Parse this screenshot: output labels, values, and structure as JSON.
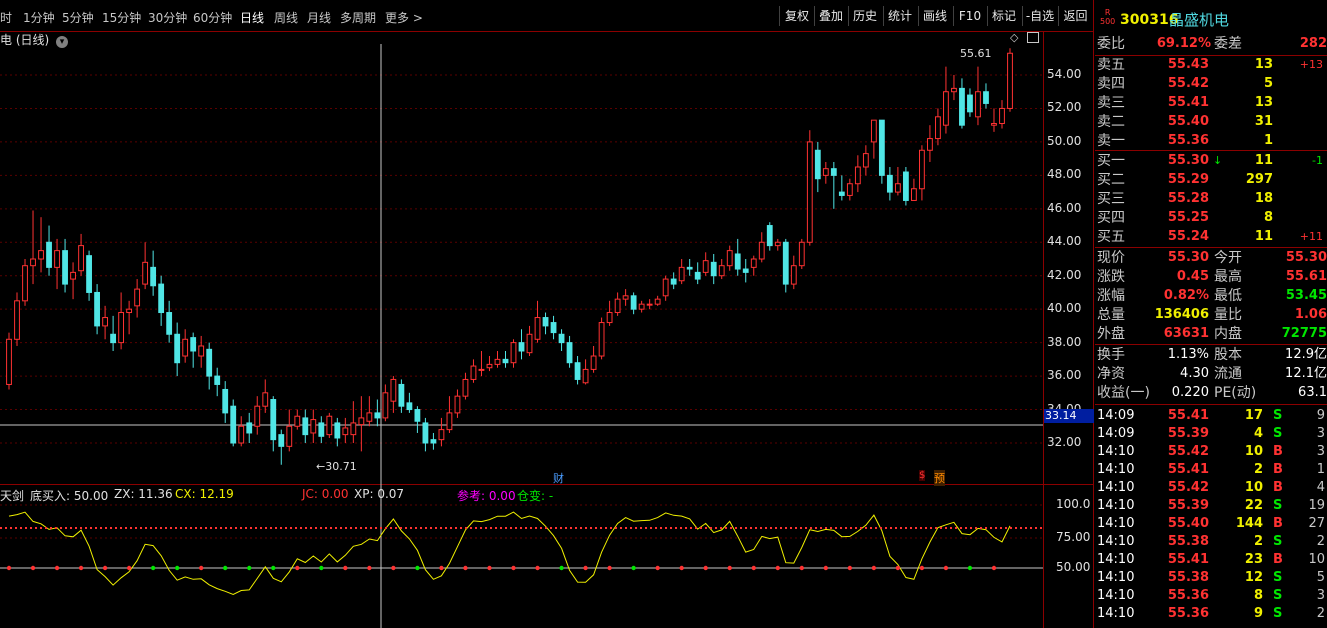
{
  "toolbar": {
    "periods": [
      "时",
      "1分钟",
      "5分钟",
      "15分钟",
      "30分钟",
      "60分钟",
      "日线",
      "周线",
      "月线",
      "多周期",
      "更多 >"
    ],
    "tools": [
      "复权",
      "叠加",
      "历史",
      "统计",
      "画线",
      "F10",
      "标记",
      "-自选",
      "返回"
    ]
  },
  "chart": {
    "title": "电 (日线)",
    "annotations": {
      "high": "55.61",
      "low": "30.71",
      "cursor_price": "33.14",
      "fin_marker": "财",
      "s_marker": "$",
      "yu_marker": "预"
    },
    "y_ticks": [
      "54.00",
      "52.00",
      "50.00",
      "48.00",
      "46.00",
      "44.00",
      "42.00",
      "40.00",
      "38.00",
      "36.00",
      "34.00",
      "32.00"
    ],
    "indicator_y_ticks": [
      "100.0",
      "75.00",
      "50.00"
    ]
  },
  "indicator": {
    "name": "天剑",
    "items": [
      {
        "label": "底买入: 50.00",
        "color": "#e0e0e0"
      },
      {
        "label": "ZX: 11.36",
        "color": "#e0e0e0"
      },
      {
        "label": "CX: 12.19",
        "color": "#f0f000"
      },
      {
        "label": "JC: 0.00",
        "color": "#ff3232"
      },
      {
        "label": "XP: 0.07",
        "color": "#e0e0e0"
      },
      {
        "label": "参考: 0.00",
        "color": "#ff00ff"
      },
      {
        "label": "仓变: -",
        "color": "#00e600"
      }
    ]
  },
  "chart_data": {
    "type": "candlestick",
    "title": "",
    "ylim": [
      30.0,
      56.5
    ],
    "up_color": "#ff3232",
    "down_color": "#50e6e6",
    "candles": [
      [
        35.5,
        38.2,
        35.2,
        38.6
      ],
      [
        38.2,
        40.5,
        37.8,
        41.0
      ],
      [
        40.5,
        42.6,
        40.2,
        43.0
      ],
      [
        42.6,
        43.0,
        41.5,
        45.9
      ],
      [
        43.0,
        43.5,
        42.2,
        45.5
      ],
      [
        44.0,
        42.5,
        42.0,
        45.0
      ],
      [
        42.5,
        43.5,
        41.2,
        44.2
      ],
      [
        43.5,
        41.5,
        41.0,
        44.2
      ],
      [
        41.8,
        42.2,
        40.6,
        42.8
      ],
      [
        42.3,
        43.8,
        42.0,
        44.5
      ],
      [
        43.2,
        41.0,
        40.5,
        43.5
      ],
      [
        41.0,
        39.0,
        38.5,
        41.5
      ],
      [
        39.0,
        39.5,
        38.2,
        40.2
      ],
      [
        38.5,
        38.0,
        37.5,
        39.6
      ],
      [
        38.0,
        39.8,
        37.6,
        41.0
      ],
      [
        39.8,
        40.0,
        38.5,
        40.5
      ],
      [
        40.2,
        41.2,
        39.5,
        41.8
      ],
      [
        41.5,
        42.8,
        41.2,
        44.0
      ],
      [
        42.5,
        41.4,
        40.8,
        43.5
      ],
      [
        41.5,
        39.8,
        39.0,
        42.0
      ],
      [
        39.8,
        38.5,
        38.0,
        40.5
      ],
      [
        38.5,
        36.8,
        36.0,
        39.2
      ],
      [
        37.2,
        38.2,
        36.8,
        38.8
      ],
      [
        38.3,
        37.5,
        36.5,
        38.6
      ],
      [
        37.2,
        37.8,
        36.5,
        38.4
      ],
      [
        37.6,
        36.0,
        35.2,
        38.0
      ],
      [
        36.0,
        35.5,
        34.8,
        36.5
      ],
      [
        35.2,
        33.8,
        33.2,
        35.7
      ],
      [
        34.2,
        32.0,
        31.8,
        34.6
      ],
      [
        32.0,
        33.0,
        31.8,
        33.6
      ],
      [
        33.2,
        32.6,
        32.0,
        33.8
      ],
      [
        33.0,
        34.2,
        32.5,
        34.8
      ],
      [
        34.2,
        35.0,
        33.8,
        35.8
      ],
      [
        34.6,
        32.2,
        31.5,
        34.8
      ],
      [
        32.5,
        31.8,
        30.7,
        32.8
      ],
      [
        31.8,
        33.0,
        31.5,
        34.0
      ],
      [
        33.0,
        33.6,
        32.8,
        34.0
      ],
      [
        33.5,
        32.5,
        32.0,
        34.0
      ],
      [
        32.6,
        33.4,
        32.0,
        34.0
      ],
      [
        33.2,
        32.4,
        32.0,
        33.6
      ],
      [
        32.5,
        33.6,
        32.3,
        33.8
      ],
      [
        33.2,
        32.3,
        31.8,
        33.5
      ],
      [
        32.5,
        32.9,
        32.0,
        33.5
      ],
      [
        32.5,
        33.2,
        32.0,
        34.5
      ],
      [
        33.1,
        33.5,
        31.5,
        34.8
      ],
      [
        33.3,
        33.8,
        33.0,
        34.8
      ],
      [
        33.8,
        33.5,
        33.0,
        34.6
      ],
      [
        33.5,
        35.0,
        33.3,
        35.5
      ],
      [
        34.5,
        35.8,
        33.8,
        36.0
      ],
      [
        35.5,
        34.2,
        33.8,
        35.8
      ],
      [
        34.4,
        34.0,
        33.8,
        35.0
      ],
      [
        34.0,
        33.3,
        32.6,
        34.2
      ],
      [
        33.2,
        32.0,
        31.5,
        33.5
      ],
      [
        32.2,
        32.0,
        31.6,
        32.6
      ],
      [
        32.2,
        32.8,
        31.8,
        33.5
      ],
      [
        32.8,
        33.8,
        32.6,
        34.8
      ],
      [
        33.8,
        34.8,
        33.5,
        35.2
      ],
      [
        34.8,
        35.8,
        34.6,
        36.2
      ],
      [
        35.8,
        36.6,
        35.6,
        37.0
      ],
      [
        36.4,
        36.4,
        36.0,
        37.5
      ],
      [
        36.5,
        36.7,
        36.3,
        37.2
      ],
      [
        36.7,
        37.0,
        36.5,
        37.5
      ],
      [
        37.0,
        36.8,
        36.5,
        37.5
      ],
      [
        36.8,
        38.0,
        36.5,
        38.2
      ],
      [
        38.0,
        37.5,
        37.0,
        38.8
      ],
      [
        37.4,
        38.5,
        37.2,
        39.0
      ],
      [
        38.2,
        39.5,
        38.0,
        40.5
      ],
      [
        39.5,
        39.0,
        38.5,
        39.8
      ],
      [
        39.2,
        38.6,
        38.2,
        39.6
      ],
      [
        38.5,
        38.0,
        37.5,
        38.8
      ],
      [
        38.0,
        36.8,
        36.5,
        38.4
      ],
      [
        36.8,
        35.8,
        35.5,
        37.2
      ],
      [
        35.6,
        36.4,
        35.5,
        37.0
      ],
      [
        36.4,
        37.2,
        36.2,
        37.8
      ],
      [
        37.2,
        39.2,
        37.0,
        39.5
      ],
      [
        39.2,
        39.8,
        39.0,
        40.5
      ],
      [
        39.8,
        40.6,
        39.6,
        41.0
      ],
      [
        40.6,
        40.8,
        40.2,
        41.2
      ],
      [
        40.8,
        40.0,
        39.7,
        41.0
      ],
      [
        40.0,
        40.3,
        39.8,
        40.5
      ],
      [
        40.3,
        40.3,
        40.0,
        40.6
      ],
      [
        40.3,
        40.6,
        40.2,
        40.8
      ],
      [
        40.8,
        41.8,
        40.5,
        42.0
      ],
      [
        41.8,
        41.5,
        41.2,
        42.2
      ],
      [
        41.7,
        42.5,
        41.5,
        43.0
      ],
      [
        42.5,
        42.4,
        42.0,
        43.0
      ],
      [
        42.2,
        41.8,
        41.5,
        42.8
      ],
      [
        42.2,
        42.9,
        42.0,
        43.4
      ],
      [
        42.8,
        42.0,
        41.5,
        43.3
      ],
      [
        42.0,
        42.6,
        41.8,
        43.0
      ],
      [
        42.6,
        43.5,
        42.3,
        43.8
      ],
      [
        43.3,
        42.4,
        42.0,
        44.2
      ],
      [
        42.4,
        42.2,
        41.6,
        43.0
      ],
      [
        42.5,
        43.0,
        42.0,
        43.2
      ],
      [
        43.0,
        44.0,
        42.8,
        44.6
      ],
      [
        45.0,
        43.8,
        43.5,
        45.2
      ],
      [
        43.8,
        44.0,
        43.5,
        44.2
      ],
      [
        44.0,
        41.5,
        41.0,
        44.2
      ],
      [
        41.5,
        42.6,
        41.2,
        43.2
      ],
      [
        42.6,
        44.0,
        42.4,
        44.2
      ],
      [
        44.0,
        50.0,
        43.8,
        50.7
      ],
      [
        49.5,
        47.8,
        47.0,
        50.0
      ],
      [
        48.0,
        48.4,
        47.5,
        48.8
      ],
      [
        48.4,
        48.0,
        46.0,
        48.8
      ],
      [
        47.0,
        46.8,
        46.5,
        48.0
      ],
      [
        46.8,
        47.5,
        46.5,
        47.8
      ],
      [
        47.5,
        48.5,
        47.0,
        49.2
      ],
      [
        48.5,
        49.3,
        48.0,
        49.8
      ],
      [
        50.0,
        51.3,
        49.0,
        51.3
      ],
      [
        51.3,
        48.0,
        47.5,
        51.3
      ],
      [
        48.0,
        47.0,
        46.5,
        48.5
      ],
      [
        47.0,
        47.5,
        46.8,
        48.5
      ],
      [
        48.2,
        46.5,
        46.2,
        48.5
      ],
      [
        46.5,
        47.2,
        46.5,
        47.8
      ],
      [
        47.2,
        49.5,
        46.5,
        49.8
      ],
      [
        49.5,
        50.2,
        48.8,
        51.0
      ],
      [
        50.2,
        51.5,
        49.8,
        52.0
      ],
      [
        51.0,
        53.0,
        50.5,
        54.5
      ],
      [
        53.0,
        53.2,
        52.5,
        54.0
      ],
      [
        53.2,
        51.0,
        50.8,
        53.8
      ],
      [
        52.8,
        51.8,
        51.5,
        53.2
      ],
      [
        51.5,
        53.0,
        51.0,
        54.5
      ],
      [
        53.0,
        52.3,
        52.0,
        53.5
      ],
      [
        51.0,
        51.1,
        50.6,
        52.0
      ],
      [
        51.1,
        52.0,
        50.8,
        52.5
      ],
      [
        52.0,
        55.3,
        51.8,
        55.6
      ]
    ]
  },
  "quote": {
    "badge_top": "R",
    "badge_bottom": "500",
    "code": "300316",
    "name": "晶盛机电",
    "webi": {
      "label1": "委比",
      "val1": "69.12%",
      "label2": "委差",
      "val2": "282"
    },
    "asks": [
      {
        "label": "卖五",
        "price": "55.43",
        "vol": "13",
        "chg": "+13"
      },
      {
        "label": "卖四",
        "price": "55.42",
        "vol": "5",
        "chg": ""
      },
      {
        "label": "卖三",
        "price": "55.41",
        "vol": "13",
        "chg": ""
      },
      {
        "label": "卖二",
        "price": "55.40",
        "vol": "31",
        "chg": ""
      },
      {
        "label": "卖一",
        "price": "55.36",
        "vol": "1",
        "chg": ""
      }
    ],
    "bids": [
      {
        "label": "买一",
        "price": "55.30",
        "vol": "11",
        "chg": "-1",
        "arrow": "↓"
      },
      {
        "label": "买二",
        "price": "55.29",
        "vol": "297",
        "chg": "",
        "arrow": ""
      },
      {
        "label": "买三",
        "price": "55.28",
        "vol": "18",
        "chg": "",
        "arrow": ""
      },
      {
        "label": "买四",
        "price": "55.25",
        "vol": "8",
        "chg": "",
        "arrow": ""
      },
      {
        "label": "买五",
        "price": "55.24",
        "vol": "11",
        "chg": "+11",
        "arrow": ""
      }
    ],
    "stats": [
      {
        "l1": "现价",
        "v1": "55.30",
        "c1": "red",
        "l2": "今开",
        "v2": "55.30",
        "c2": "red"
      },
      {
        "l1": "涨跌",
        "v1": "0.45",
        "c1": "red",
        "l2": "最高",
        "v2": "55.61",
        "c2": "red"
      },
      {
        "l1": "涨幅",
        "v1": "0.82%",
        "c1": "red",
        "l2": "最低",
        "v2": "53.45",
        "c2": "grn"
      },
      {
        "l1": "总量",
        "v1": "136406",
        "c1": "yel",
        "l2": "量比",
        "v2": "1.06",
        "c2": "red"
      },
      {
        "l1": "外盘",
        "v1": "63631",
        "c1": "red",
        "l2": "内盘",
        "v2": "72775",
        "c2": "grn"
      }
    ],
    "stats2": [
      {
        "l1": "换手",
        "v1": "1.13%",
        "l2": "股本",
        "v2": "12.9亿"
      },
      {
        "l1": "净资",
        "v1": "4.30",
        "l2": "流通",
        "v2": "12.1亿"
      },
      {
        "l1": "收益(一)",
        "v1": "0.220",
        "l2": "PE(动)",
        "v2": "63.1"
      }
    ],
    "ticks": [
      {
        "time": "14:09",
        "price": "55.41",
        "vol": "17",
        "side": "S",
        "n": "9"
      },
      {
        "time": "14:09",
        "price": "55.39",
        "vol": "4",
        "side": "S",
        "n": "3"
      },
      {
        "time": "14:10",
        "price": "55.42",
        "vol": "10",
        "side": "B",
        "n": "3"
      },
      {
        "time": "14:10",
        "price": "55.41",
        "vol": "2",
        "side": "B",
        "n": "1"
      },
      {
        "time": "14:10",
        "price": "55.42",
        "vol": "10",
        "side": "B",
        "n": "4"
      },
      {
        "time": "14:10",
        "price": "55.39",
        "vol": "22",
        "side": "S",
        "n": "19"
      },
      {
        "time": "14:10",
        "price": "55.40",
        "vol": "144",
        "side": "B",
        "n": "27"
      },
      {
        "time": "14:10",
        "price": "55.38",
        "vol": "2",
        "side": "S",
        "n": "2"
      },
      {
        "time": "14:10",
        "price": "55.41",
        "vol": "23",
        "side": "B",
        "n": "10"
      },
      {
        "time": "14:10",
        "price": "55.38",
        "vol": "12",
        "side": "S",
        "n": "5"
      },
      {
        "time": "14:10",
        "price": "55.36",
        "vol": "8",
        "side": "S",
        "n": "3"
      },
      {
        "time": "14:10",
        "price": "55.36",
        "vol": "9",
        "side": "S",
        "n": "2"
      }
    ]
  }
}
